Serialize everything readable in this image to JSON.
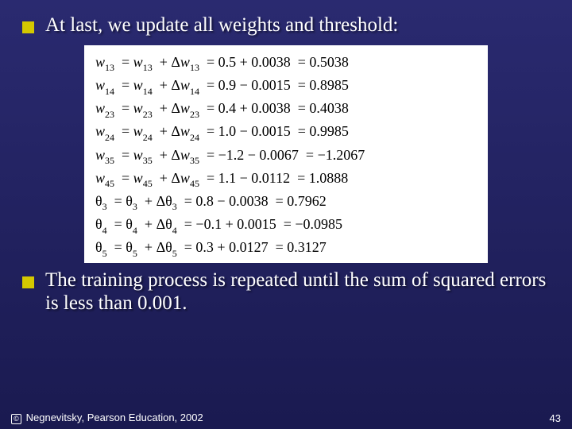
{
  "bullets": {
    "top": "At last, we update all weights and threshold:",
    "bottom": "The training process is repeated until the sum of squared errors is less than 0.001."
  },
  "equations": {
    "w13": {
      "lhs_var": "w",
      "lhs_sub": "13",
      "a_var": "w",
      "a_sub": "13",
      "d_var": "w",
      "d_sub": "13",
      "val1": "0.5",
      "op1": "+",
      "val2": "0.0038",
      "res": "0.5038"
    },
    "w14": {
      "lhs_var": "w",
      "lhs_sub": "14",
      "a_var": "w",
      "a_sub": "14",
      "d_var": "w",
      "d_sub": "14",
      "val1": "0.9",
      "op1": "−",
      "val2": "0.0015",
      "res": "0.8985"
    },
    "w23": {
      "lhs_var": "w",
      "lhs_sub": "23",
      "a_var": "w",
      "a_sub": "23",
      "d_var": "w",
      "d_sub": "23",
      "val1": "0.4",
      "op1": "+",
      "val2": "0.0038",
      "res": "0.4038"
    },
    "w24": {
      "lhs_var": "w",
      "lhs_sub": "24",
      "a_var": "w",
      "a_sub": "24",
      "d_var": "w",
      "d_sub": "24",
      "val1": "1.0",
      "op1": "−",
      "val2": "0.0015",
      "res": "0.9985"
    },
    "w35": {
      "lhs_var": "w",
      "lhs_sub": "35",
      "a_var": "w",
      "a_sub": "35",
      "d_var": "w",
      "d_sub": "35",
      "val1": "−1.2",
      "op1": "−",
      "val2": "0.0067",
      "res": "−1.2067"
    },
    "w45": {
      "lhs_var": "w",
      "lhs_sub": "45",
      "a_var": "w",
      "a_sub": "45",
      "d_var": "w",
      "d_sub": "45",
      "val1": "1.1",
      "op1": "−",
      "val2": "0.0112",
      "res": "1.0888"
    },
    "t3": {
      "lhs_var": "θ",
      "lhs_sub": "3",
      "a_var": "θ",
      "a_sub": "3",
      "d_var": "θ",
      "d_sub": "3",
      "val1": "0.8",
      "op1": "−",
      "val2": "0.0038",
      "res": "0.7962"
    },
    "t4": {
      "lhs_var": "θ",
      "lhs_sub": "4",
      "a_var": "θ",
      "a_sub": "4",
      "d_var": "θ",
      "d_sub": "4",
      "val1": "−0.1",
      "op1": "+",
      "val2": "0.0015",
      "res": "−0.0985"
    },
    "t5": {
      "lhs_var": "θ",
      "lhs_sub": "5",
      "a_var": "θ",
      "a_sub": "5",
      "d_var": "θ",
      "d_sub": "5",
      "val1": "0.3",
      "op1": "+",
      "val2": "0.0127",
      "res": "0.3127"
    }
  },
  "footer": {
    "copyright": "Negnevitsky, Pearson Education, 2002",
    "page": "43"
  }
}
